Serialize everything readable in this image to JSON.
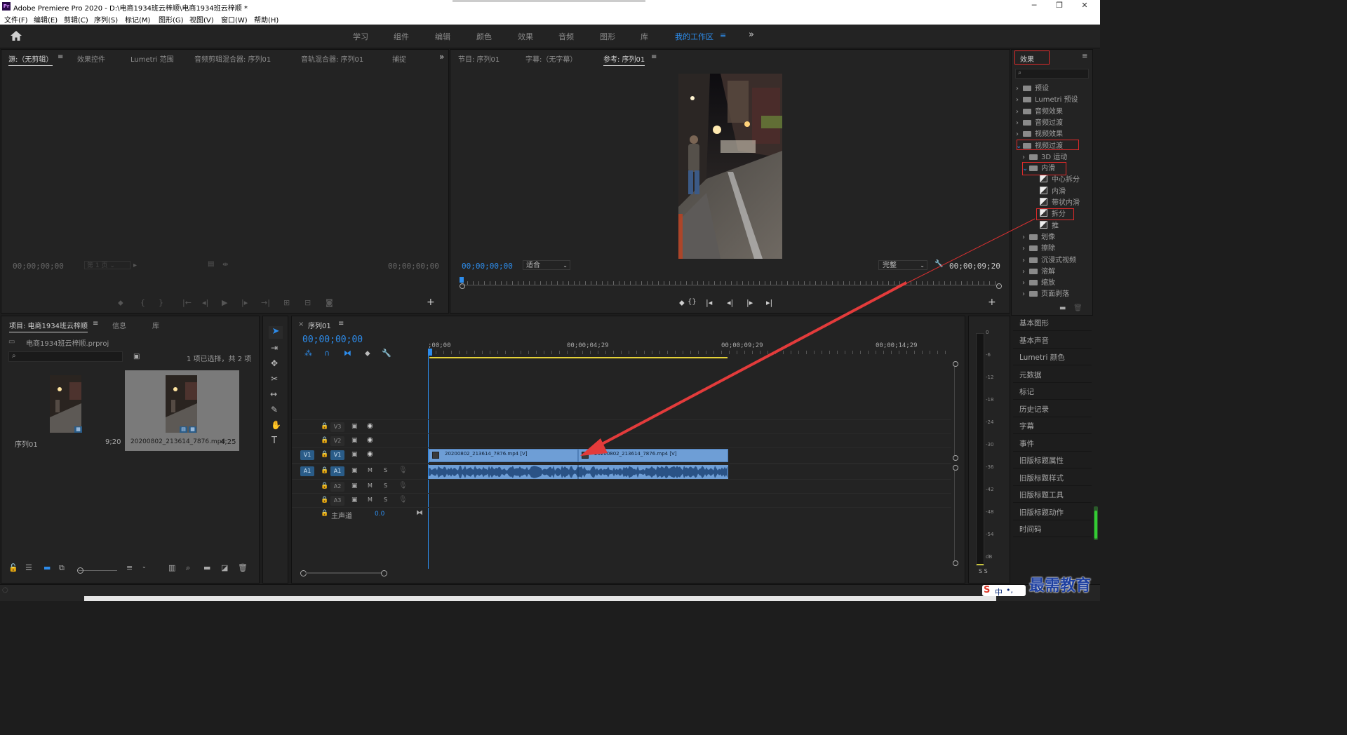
{
  "window": {
    "title": "Adobe Premiere Pro 2020 - D:\\电商1934班云梓顺\\电商1934班云梓顺 *",
    "app_icon": "Pr"
  },
  "menu": [
    "文件(F)",
    "编辑(E)",
    "剪辑(C)",
    "序列(S)",
    "标记(M)",
    "图形(G)",
    "视图(V)",
    "窗口(W)",
    "帮助(H)"
  ],
  "workspaces": [
    "学习",
    "组件",
    "编辑",
    "颜色",
    "效果",
    "音频",
    "图形",
    "库",
    "我的工作区"
  ],
  "source_panel": {
    "tabs": [
      "源:（无剪辑）",
      "效果控件",
      "Lumetri 范围",
      "音频剪辑混合器: 序列01",
      "音轨混合器: 序列01",
      "捕捉"
    ],
    "timecode_left": "00;00;00;00",
    "page": "第 1 页",
    "timecode_right": "00;00;00;00"
  },
  "program_panel": {
    "tabs": [
      "节目: 序列01",
      "字幕:（无字幕）",
      "参考: 序列01"
    ],
    "timecode": "00;00;00;00",
    "fit": "适合",
    "quality": "完整",
    "duration": "00;00;09;20"
  },
  "project_panel": {
    "tabs": [
      "项目: 电商1934班云梓顺",
      "信息",
      "库"
    ],
    "file": "电商1934班云梓顺.prproj",
    "selection_info": "1 项已选择，共 2 项",
    "items": [
      {
        "name": "序列01",
        "duration": "9;20"
      },
      {
        "name": "20200802_213614_7876.mp4",
        "duration": "4;25"
      }
    ]
  },
  "timeline": {
    "tab": "序列01",
    "timecode": "00;00;00;00",
    "ruler": [
      ";00;00",
      "00;00;04;29",
      "00;00;09;29",
      "00;00;14;29"
    ],
    "tracks": [
      {
        "src": "",
        "name": "V3",
        "type": "video"
      },
      {
        "src": "",
        "name": "V2",
        "type": "video"
      },
      {
        "src": "V1",
        "name": "V1",
        "type": "video"
      },
      {
        "src": "A1",
        "name": "A1",
        "type": "audio"
      },
      {
        "src": "",
        "name": "A2",
        "type": "audio"
      },
      {
        "src": "",
        "name": "A3",
        "type": "audio"
      }
    ],
    "mute": "M",
    "solo": "S",
    "master_label": "主声道",
    "master_value": "0.0",
    "clips": [
      {
        "label": "20200802_213614_7876.mp4 [V]"
      },
      {
        "label": "20200802_213614_7876.mp4 [V]"
      }
    ]
  },
  "effects_panel": {
    "title": "效果",
    "tree": [
      {
        "label": "预设",
        "level": 0,
        "kind": "folder",
        "open": false
      },
      {
        "label": "Lumetri 预设",
        "level": 0,
        "kind": "folder",
        "open": false
      },
      {
        "label": "音频效果",
        "level": 0,
        "kind": "folder",
        "open": false
      },
      {
        "label": "音频过渡",
        "level": 0,
        "kind": "folder",
        "open": false
      },
      {
        "label": "视频效果",
        "level": 0,
        "kind": "folder",
        "open": false
      },
      {
        "label": "视频过渡",
        "level": 0,
        "kind": "folder",
        "open": true
      },
      {
        "label": "3D 运动",
        "level": 1,
        "kind": "folder",
        "open": false
      },
      {
        "label": "内滑",
        "level": 1,
        "kind": "folder",
        "open": true
      },
      {
        "label": "中心拆分",
        "level": 2,
        "kind": "item"
      },
      {
        "label": "内滑",
        "level": 2,
        "kind": "item"
      },
      {
        "label": "带状内滑",
        "level": 2,
        "kind": "item"
      },
      {
        "label": "拆分",
        "level": 2,
        "kind": "item"
      },
      {
        "label": "推",
        "level": 2,
        "kind": "item"
      },
      {
        "label": "划像",
        "level": 1,
        "kind": "folder",
        "open": false
      },
      {
        "label": "擦除",
        "level": 1,
        "kind": "folder",
        "open": false
      },
      {
        "label": "沉浸式视频",
        "level": 1,
        "kind": "folder",
        "open": false
      },
      {
        "label": "溶解",
        "level": 1,
        "kind": "folder",
        "open": false
      },
      {
        "label": "缩放",
        "level": 1,
        "kind": "folder",
        "open": false
      },
      {
        "label": "页面剥落",
        "level": 1,
        "kind": "folder",
        "open": false
      }
    ]
  },
  "right_panels": [
    "基本图形",
    "基本声音",
    "Lumetri 颜色",
    "元数据",
    "标记",
    "历史记录",
    "字幕",
    "事件",
    "旧版标题属性",
    "旧版标题样式",
    "旧版标题工具",
    "旧版标题动作",
    "时间码"
  ],
  "audio_meter": {
    "ticks": [
      "0",
      "-6",
      "-12",
      "-18",
      "-24",
      "-30",
      "-36",
      "-42",
      "-48",
      "-54",
      "dB"
    ],
    "solo_labels": "S S"
  },
  "watermark": "最需教育",
  "ime": "中"
}
